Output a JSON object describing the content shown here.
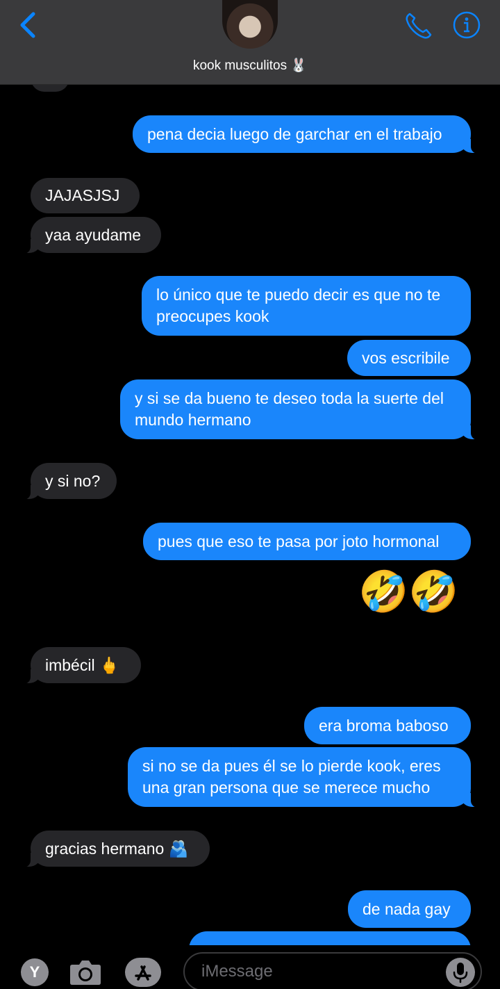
{
  "header": {
    "contact_name": "kook musculitos 🐰"
  },
  "messages": [
    {
      "text": "pena decia luego de garchar en el trabajo",
      "sender": "me"
    },
    {
      "text": "JAJASJSJ",
      "sender": "them"
    },
    {
      "text": "yaa ayudame",
      "sender": "them"
    },
    {
      "text": "lo único que te puedo decir es que no te preocupes kook",
      "sender": "me"
    },
    {
      "text": "vos escribile",
      "sender": "me"
    },
    {
      "text": "y si se da bueno te deseo toda la suerte del mundo hermano",
      "sender": "me"
    },
    {
      "text": "y si no?",
      "sender": "them"
    },
    {
      "text": "pues que eso te pasa por joto hormonal",
      "sender": "me"
    },
    {
      "text": "🤣🤣",
      "sender": "me"
    },
    {
      "text": "imbécil 🖕",
      "sender": "them"
    },
    {
      "text": "era broma baboso",
      "sender": "me"
    },
    {
      "text": "si no se da pues él se lo pierde kook, eres una gran persona que se merece mucho",
      "sender": "me"
    },
    {
      "text": "gracias hermano 🫂",
      "sender": "them"
    },
    {
      "text": "de nada gay",
      "sender": "me"
    }
  ],
  "composer": {
    "apps_badge": "Y",
    "placeholder": "iMessage"
  },
  "colors": {
    "outgoing_bubble": "#1a86fb",
    "incoming_bubble": "#262629",
    "accent": "#0a84ff"
  }
}
